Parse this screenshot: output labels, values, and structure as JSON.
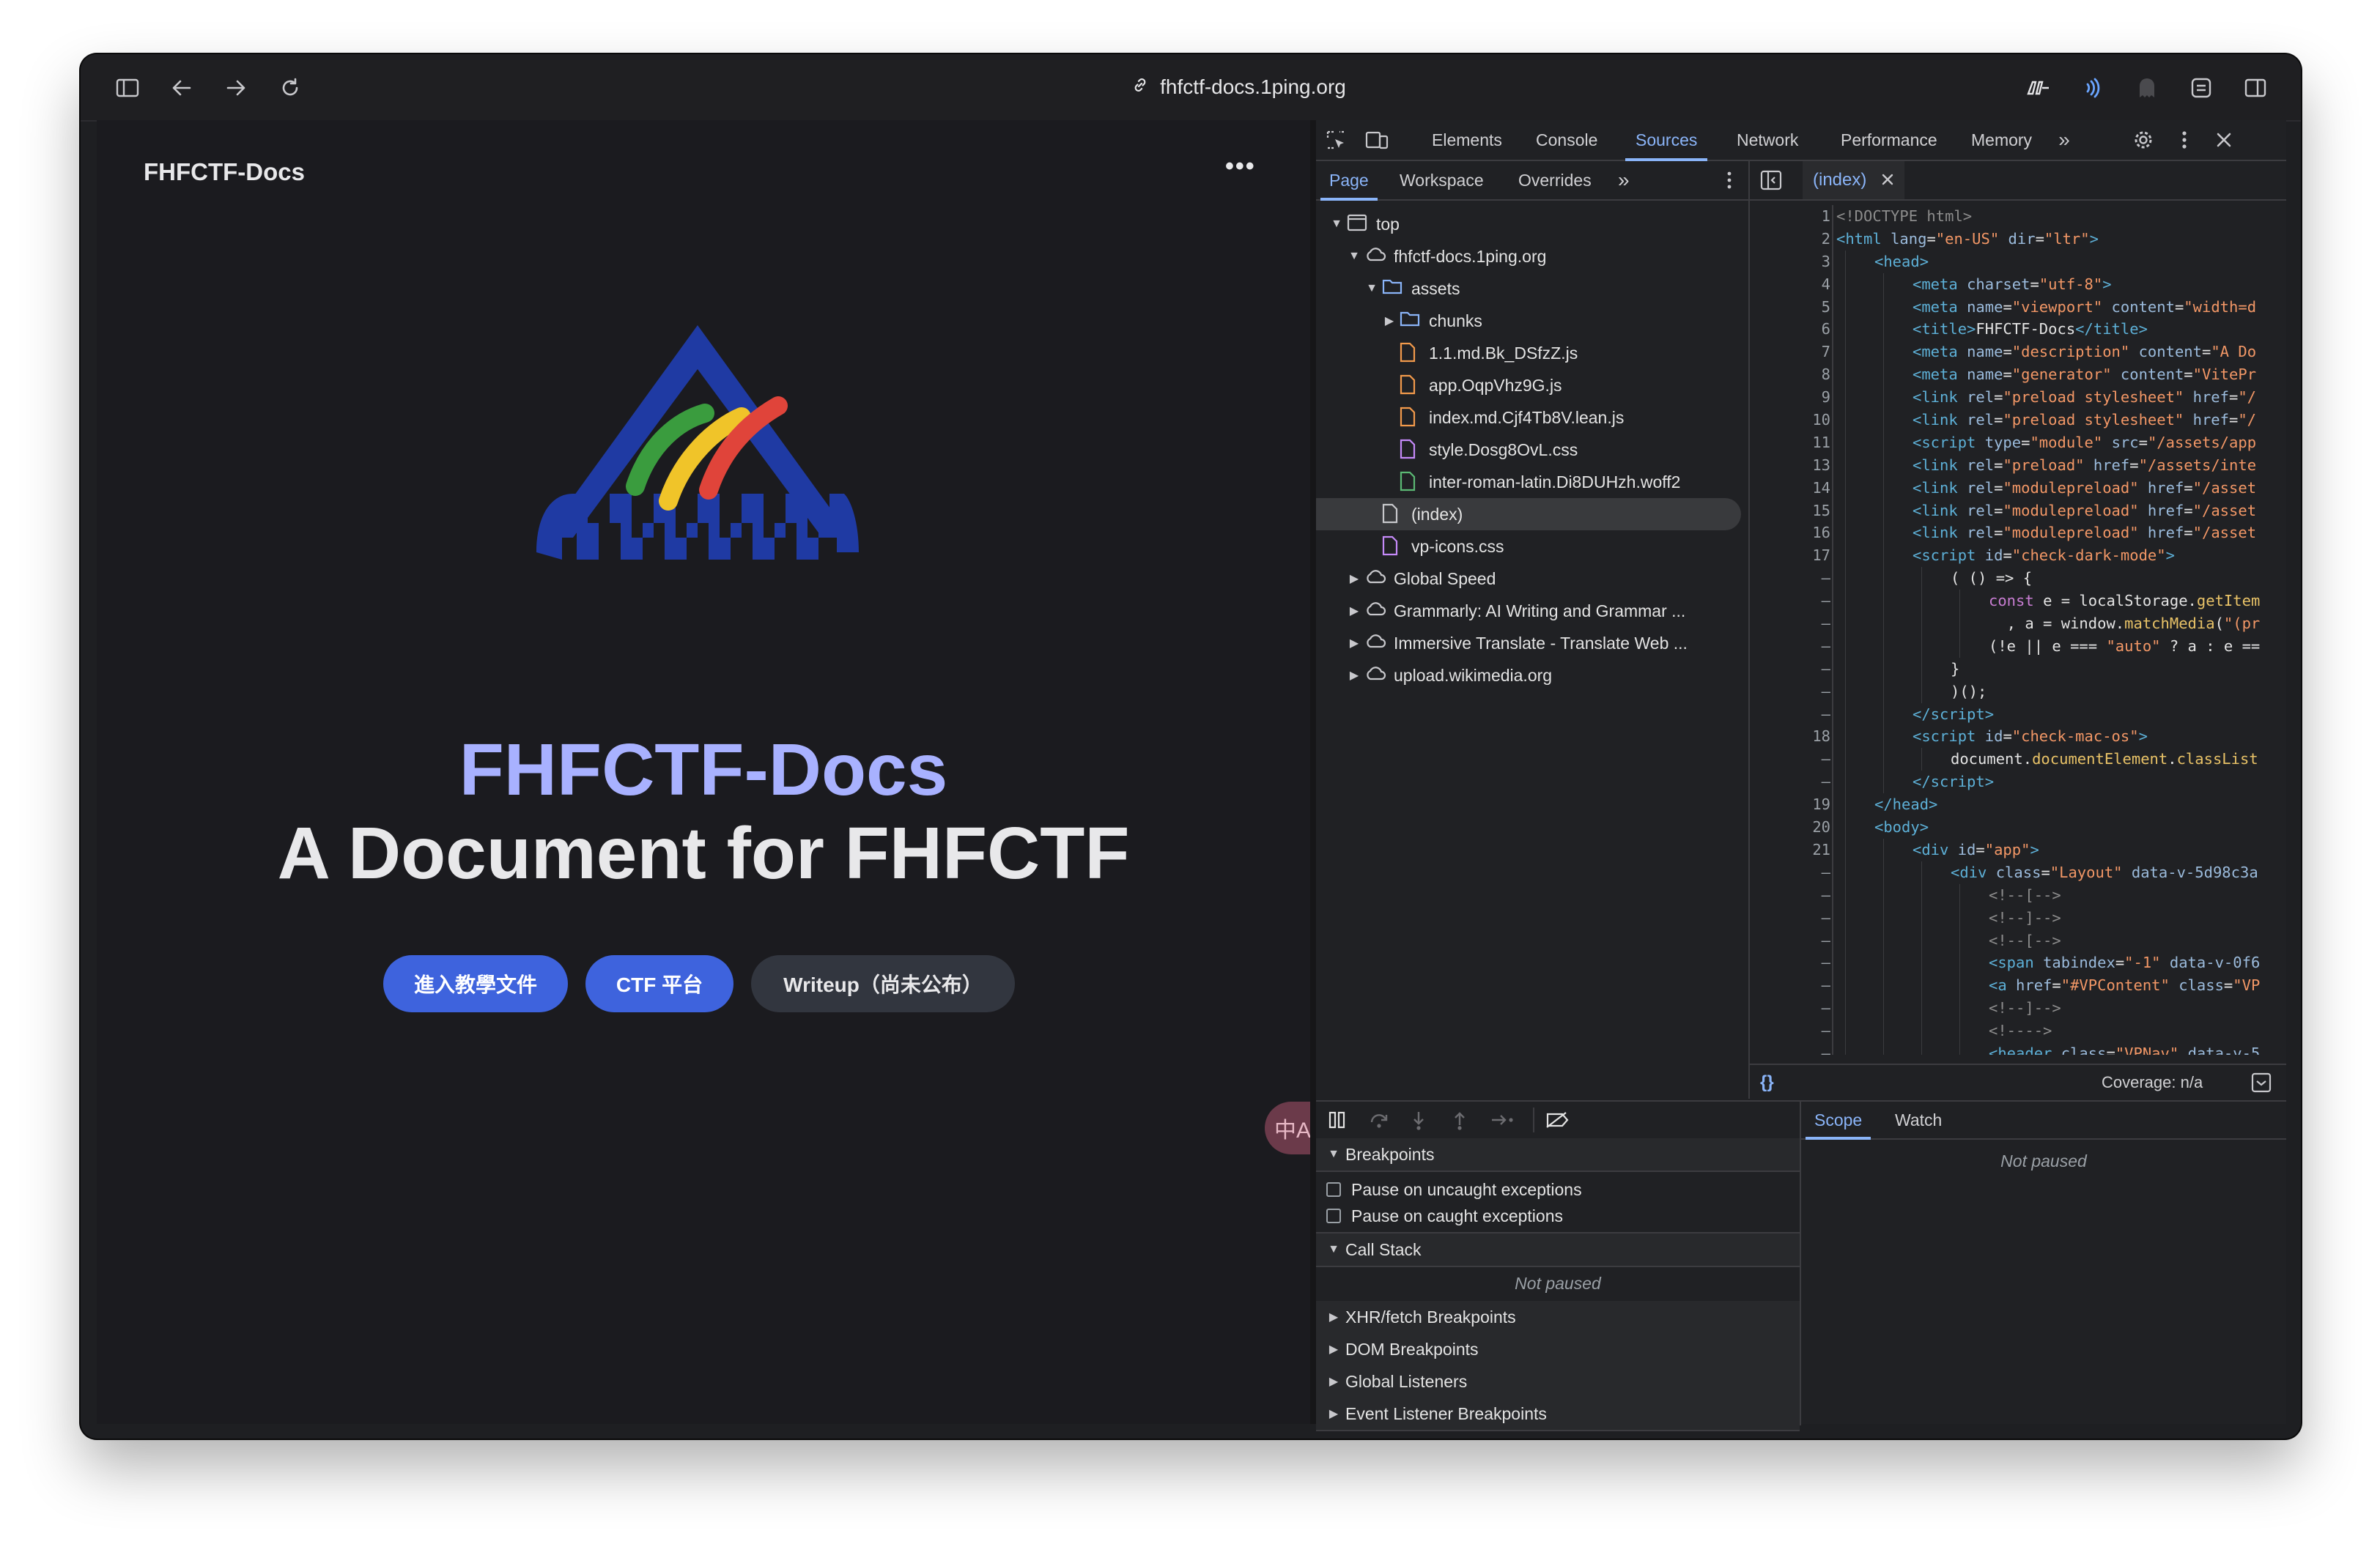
{
  "browser": {
    "url": "fhfctf-docs.1ping.org"
  },
  "site": {
    "nav_title": "FHFCTF-Docs",
    "menu_dots": "•••",
    "hero_name": "FHFCTF-Docs",
    "hero_text": "A Document for FHFCTF",
    "buttons": [
      "進入教學文件",
      "CTF 平台",
      "Writeup（尚未公布）"
    ],
    "translate_label": "中A"
  },
  "devtools": {
    "tabs": [
      "Elements",
      "Console",
      "Sources",
      "Network",
      "Performance",
      "Memory"
    ],
    "active_tab": "Sources",
    "more": "»",
    "nav_tabs": [
      "Page",
      "Workspace",
      "Overrides"
    ],
    "tree": [
      {
        "label": "top",
        "depth": 0,
        "icon": "frame",
        "arrow": "down"
      },
      {
        "label": "fhfctf-docs.1ping.org",
        "depth": 1,
        "icon": "cloud",
        "arrow": "down"
      },
      {
        "label": "assets",
        "depth": 2,
        "icon": "folder",
        "arrow": "down"
      },
      {
        "label": "chunks",
        "depth": 3,
        "icon": "folder",
        "arrow": "right"
      },
      {
        "label": "1.1.md.Bk_DSfzZ.js",
        "depth": 3,
        "icon": "js",
        "arrow": ""
      },
      {
        "label": "app.OqpVhz9G.js",
        "depth": 3,
        "icon": "js",
        "arrow": ""
      },
      {
        "label": "index.md.Cjf4Tb8V.lean.js",
        "depth": 3,
        "icon": "js",
        "arrow": ""
      },
      {
        "label": "style.Dosg8OvL.css",
        "depth": 3,
        "icon": "css",
        "arrow": ""
      },
      {
        "label": "inter-roman-latin.Di8DUHzh.woff2",
        "depth": 3,
        "icon": "font",
        "arrow": ""
      },
      {
        "label": "(index)",
        "depth": 2,
        "icon": "doc",
        "arrow": "",
        "selected": true
      },
      {
        "label": "vp-icons.css",
        "depth": 2,
        "icon": "css",
        "arrow": ""
      },
      {
        "label": "Global Speed",
        "depth": 1,
        "icon": "cloud",
        "arrow": "right"
      },
      {
        "label": "Grammarly: AI Writing and Grammar ...",
        "depth": 1,
        "icon": "cloud",
        "arrow": "right"
      },
      {
        "label": "Immersive Translate - Translate Web ...",
        "depth": 1,
        "icon": "cloud",
        "arrow": "right"
      },
      {
        "label": "upload.wikimedia.org",
        "depth": 1,
        "icon": "cloud",
        "arrow": "right"
      }
    ],
    "editor_tab": "(index)",
    "code_lines": [
      {
        "n": "1",
        "indent": 0,
        "html": "<span class=\"cm\">&lt;!DOCTYPE html&gt;</span>"
      },
      {
        "n": "2",
        "indent": 0,
        "html": "<span class=\"tag\">&lt;html</span> <span class=\"an\">lang</span>=<span class=\"av\">\"en-US\"</span> <span class=\"an\">dir</span>=<span class=\"av\">\"ltr\"</span><span class=\"tag\">&gt;</span>"
      },
      {
        "n": "3",
        "indent": 1,
        "html": "<span class=\"tag\">&lt;head&gt;</span>"
      },
      {
        "n": "4",
        "indent": 2,
        "html": "<span class=\"tag\">&lt;meta</span> <span class=\"an\">charset</span>=<span class=\"av\">\"utf-8\"</span><span class=\"tag\">&gt;</span>"
      },
      {
        "n": "5",
        "indent": 2,
        "html": "<span class=\"tag\">&lt;meta</span> <span class=\"an\">name</span>=<span class=\"av\">\"viewport\"</span> <span class=\"an\">content</span>=<span class=\"av\">\"width=d</span>"
      },
      {
        "n": "6",
        "indent": 2,
        "html": "<span class=\"tag\">&lt;title&gt;</span><span class=\"pl\">FHFCTF-Docs</span><span class=\"tag\">&lt;/title&gt;</span>"
      },
      {
        "n": "7",
        "indent": 2,
        "html": "<span class=\"tag\">&lt;meta</span> <span class=\"an\">name</span>=<span class=\"av\">\"description\"</span> <span class=\"an\">content</span>=<span class=\"av\">\"A Do</span>"
      },
      {
        "n": "8",
        "indent": 2,
        "html": "<span class=\"tag\">&lt;meta</span> <span class=\"an\">name</span>=<span class=\"av\">\"generator\"</span> <span class=\"an\">content</span>=<span class=\"av\">\"VitePr</span>"
      },
      {
        "n": "9",
        "indent": 2,
        "html": "<span class=\"tag\">&lt;link</span> <span class=\"an\">rel</span>=<span class=\"av\">\"preload stylesheet\"</span> <span class=\"an\">href</span>=<span class=\"av\">\"/</span>"
      },
      {
        "n": "10",
        "indent": 2,
        "html": "<span class=\"tag\">&lt;link</span> <span class=\"an\">rel</span>=<span class=\"av\">\"preload stylesheet\"</span> <span class=\"an\">href</span>=<span class=\"av\">\"/</span>"
      },
      {
        "n": "11",
        "indent": 2,
        "html": "<span class=\"tag\">&lt;script</span> <span class=\"an\">type</span>=<span class=\"av\">\"module\"</span> <span class=\"an\">src</span>=<span class=\"av\">\"/assets/app</span>"
      },
      {
        "n": "13",
        "indent": 2,
        "html": "<span class=\"tag\">&lt;link</span> <span class=\"an\">rel</span>=<span class=\"av\">\"preload\"</span> <span class=\"an\">href</span>=<span class=\"av\">\"/assets/inte</span>"
      },
      {
        "n": "14",
        "indent": 2,
        "html": "<span class=\"tag\">&lt;link</span> <span class=\"an\">rel</span>=<span class=\"av\">\"modulepreload\"</span> <span class=\"an\">href</span>=<span class=\"av\">\"/asset</span>"
      },
      {
        "n": "15",
        "indent": 2,
        "html": "<span class=\"tag\">&lt;link</span> <span class=\"an\">rel</span>=<span class=\"av\">\"modulepreload\"</span> <span class=\"an\">href</span>=<span class=\"av\">\"/asset</span>"
      },
      {
        "n": "16",
        "indent": 2,
        "html": "<span class=\"tag\">&lt;link</span> <span class=\"an\">rel</span>=<span class=\"av\">\"modulepreload\"</span> <span class=\"an\">href</span>=<span class=\"av\">\"/asset</span>"
      },
      {
        "n": "17",
        "indent": 2,
        "html": "<span class=\"tag\">&lt;script</span> <span class=\"an\">id</span>=<span class=\"av\">\"check-dark-mode\"</span><span class=\"tag\">&gt;</span>"
      },
      {
        "n": "–",
        "indent": 3,
        "html": "<span class=\"pl\">( () =&gt; {</span>"
      },
      {
        "n": "–",
        "indent": 4,
        "html": "<span class=\"kw\">const</span> <span class=\"pl\">e = localStorage.</span><span class=\"fn\">getItem</span>"
      },
      {
        "n": "–",
        "indent": 4,
        "html": "<span class=\"pl\">  , a = window.</span><span class=\"fn\">matchMedia</span><span class=\"pl\">(</span><span class=\"av\">\"(pr</span>"
      },
      {
        "n": "–",
        "indent": 4,
        "html": "<span class=\"pl\">(!e || e === </span><span class=\"av\">\"auto\"</span><span class=\"pl\"> ? a : e ==</span>"
      },
      {
        "n": "–",
        "indent": 3,
        "html": "<span class=\"pl\">}</span>"
      },
      {
        "n": "–",
        "indent": 3,
        "html": "<span class=\"pl\">)();</span>"
      },
      {
        "n": "–",
        "indent": 2,
        "html": "<span class=\"tag\">&lt;/script&gt;</span>"
      },
      {
        "n": "18",
        "indent": 2,
        "html": "<span class=\"tag\">&lt;script</span> <span class=\"an\">id</span>=<span class=\"av\">\"check-mac-os\"</span><span class=\"tag\">&gt;</span>"
      },
      {
        "n": "–",
        "indent": 3,
        "html": "<span class=\"pl\">document.</span><span class=\"fn\">documentElement</span><span class=\"pl\">.</span><span class=\"fn\">classList</span>"
      },
      {
        "n": "–",
        "indent": 2,
        "html": "<span class=\"tag\">&lt;/script&gt;</span>"
      },
      {
        "n": "19",
        "indent": 1,
        "html": "<span class=\"tag\">&lt;/head&gt;</span>"
      },
      {
        "n": "20",
        "indent": 1,
        "html": "<span class=\"tag\">&lt;body&gt;</span>"
      },
      {
        "n": "21",
        "indent": 2,
        "html": "<span class=\"tag\">&lt;div</span> <span class=\"an\">id</span>=<span class=\"av\">\"app\"</span><span class=\"tag\">&gt;</span>"
      },
      {
        "n": "–",
        "indent": 3,
        "html": "<span class=\"tag\">&lt;div</span> <span class=\"an\">class</span>=<span class=\"av\">\"Layout\"</span> <span class=\"an\">data-v-5d98c3a</span>"
      },
      {
        "n": "–",
        "indent": 4,
        "html": "<span class=\"cm\">&lt;!--[--&gt;</span>"
      },
      {
        "n": "–",
        "indent": 4,
        "html": "<span class=\"cm\">&lt;!--]--&gt;</span>"
      },
      {
        "n": "–",
        "indent": 4,
        "html": "<span class=\"cm\">&lt;!--[--&gt;</span>"
      },
      {
        "n": "–",
        "indent": 4,
        "html": "<span class=\"tag\">&lt;span</span> <span class=\"an\">tabindex</span>=<span class=\"av\">\"-1\"</span> <span class=\"an\">data-v-0f6</span>"
      },
      {
        "n": "–",
        "indent": 4,
        "html": "<span class=\"tag\">&lt;a</span> <span class=\"an\">href</span>=<span class=\"av\">\"#VPContent\"</span> <span class=\"an\">class</span>=<span class=\"av\">\"VP</span>"
      },
      {
        "n": "–",
        "indent": 4,
        "html": "<span class=\"cm\">&lt;!--]--&gt;</span>"
      },
      {
        "n": "–",
        "indent": 4,
        "html": "<span class=\"cm\">&lt;!----&gt;</span>"
      },
      {
        "n": "–",
        "indent": 4,
        "html": "<span class=\"tag\">&lt;header</span> <span class=\"an\">class</span>=<span class=\"av\">\"VPNav\"</span> <span class=\"an\">data-v-5</span>"
      }
    ],
    "coverage": "Coverage: n/a",
    "format_icon_label": "{}",
    "debugger": {
      "breakpoints_header": "Breakpoints",
      "pause_uncaught": "Pause on uncaught exceptions",
      "pause_caught": "Pause on caught exceptions",
      "call_stack_header": "Call Stack",
      "not_paused": "Not paused",
      "sections": [
        "XHR/fetch Breakpoints",
        "DOM Breakpoints",
        "Global Listeners",
        "Event Listener Breakpoints"
      ],
      "right_tabs": [
        "Scope",
        "Watch"
      ],
      "right_not_paused": "Not paused"
    }
  },
  "colors": {
    "accent": "#8ab4f8",
    "brand_button": "#3e63dd",
    "hero_name": "#a8b1ff"
  }
}
